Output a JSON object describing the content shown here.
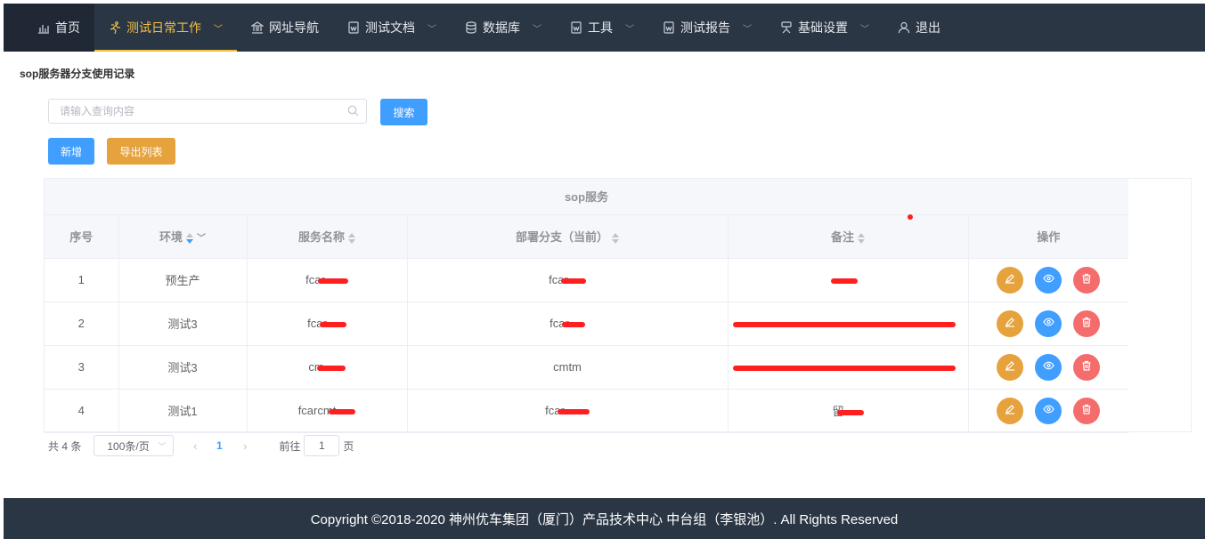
{
  "nav": {
    "items": [
      {
        "label": "首页",
        "icon": "bar-chart-icon",
        "dropdown": false
      },
      {
        "label": "测试日常工作",
        "icon": "running-icon",
        "dropdown": true,
        "active": true
      },
      {
        "label": "网址导航",
        "icon": "bank-icon",
        "dropdown": false
      },
      {
        "label": "测试文档",
        "icon": "document-icon",
        "dropdown": true
      },
      {
        "label": "数据库",
        "icon": "database-icon",
        "dropdown": true
      },
      {
        "label": "工具",
        "icon": "document-icon",
        "dropdown": true
      },
      {
        "label": "测试报告",
        "icon": "document-icon",
        "dropdown": true
      },
      {
        "label": "基础设置",
        "icon": "settings-icon",
        "dropdown": true
      },
      {
        "label": "退出",
        "icon": "user-icon",
        "dropdown": false
      }
    ],
    "active_color": "#f0c045",
    "bg_color": "#2b3644"
  },
  "page": {
    "title": "sop服务器分支使用记录"
  },
  "search": {
    "placeholder": "请输入查询内容",
    "value": "",
    "button_label": "搜索"
  },
  "actions": {
    "add_label": "新增",
    "export_label": "导出列表"
  },
  "table": {
    "group_header": "sop服务",
    "columns": [
      "序号",
      "环境",
      "服务名称",
      "部署分支（当前）",
      "备注",
      "操作"
    ],
    "rows": [
      {
        "index": "1",
        "env": "预生产",
        "service": "fcar",
        "branch": "fcar",
        "note": ""
      },
      {
        "index": "2",
        "env": "测试3",
        "service": "fcar",
        "branch": "fcar",
        "note": ""
      },
      {
        "index": "3",
        "env": "测试3",
        "service": "cm",
        "branch": "cmtm",
        "note": ""
      },
      {
        "index": "4",
        "env": "测试1",
        "service": "fcarcmt",
        "branch": "fcar",
        "note": "留"
      }
    ]
  },
  "pagination": {
    "total_label": "共 4 条",
    "page_size_label": "100条/页",
    "current_page": "1",
    "goto_label": "前往",
    "goto_value": "1",
    "page_suffix": "页"
  },
  "footer": {
    "text": "Copyright ©2018-2020 神州优车集团（厦门）产品技术中心 中台组（李银池）. All Rights Reserved"
  },
  "colors": {
    "primary": "#409eff",
    "warning": "#e6a23c",
    "danger": "#f56c6c"
  }
}
